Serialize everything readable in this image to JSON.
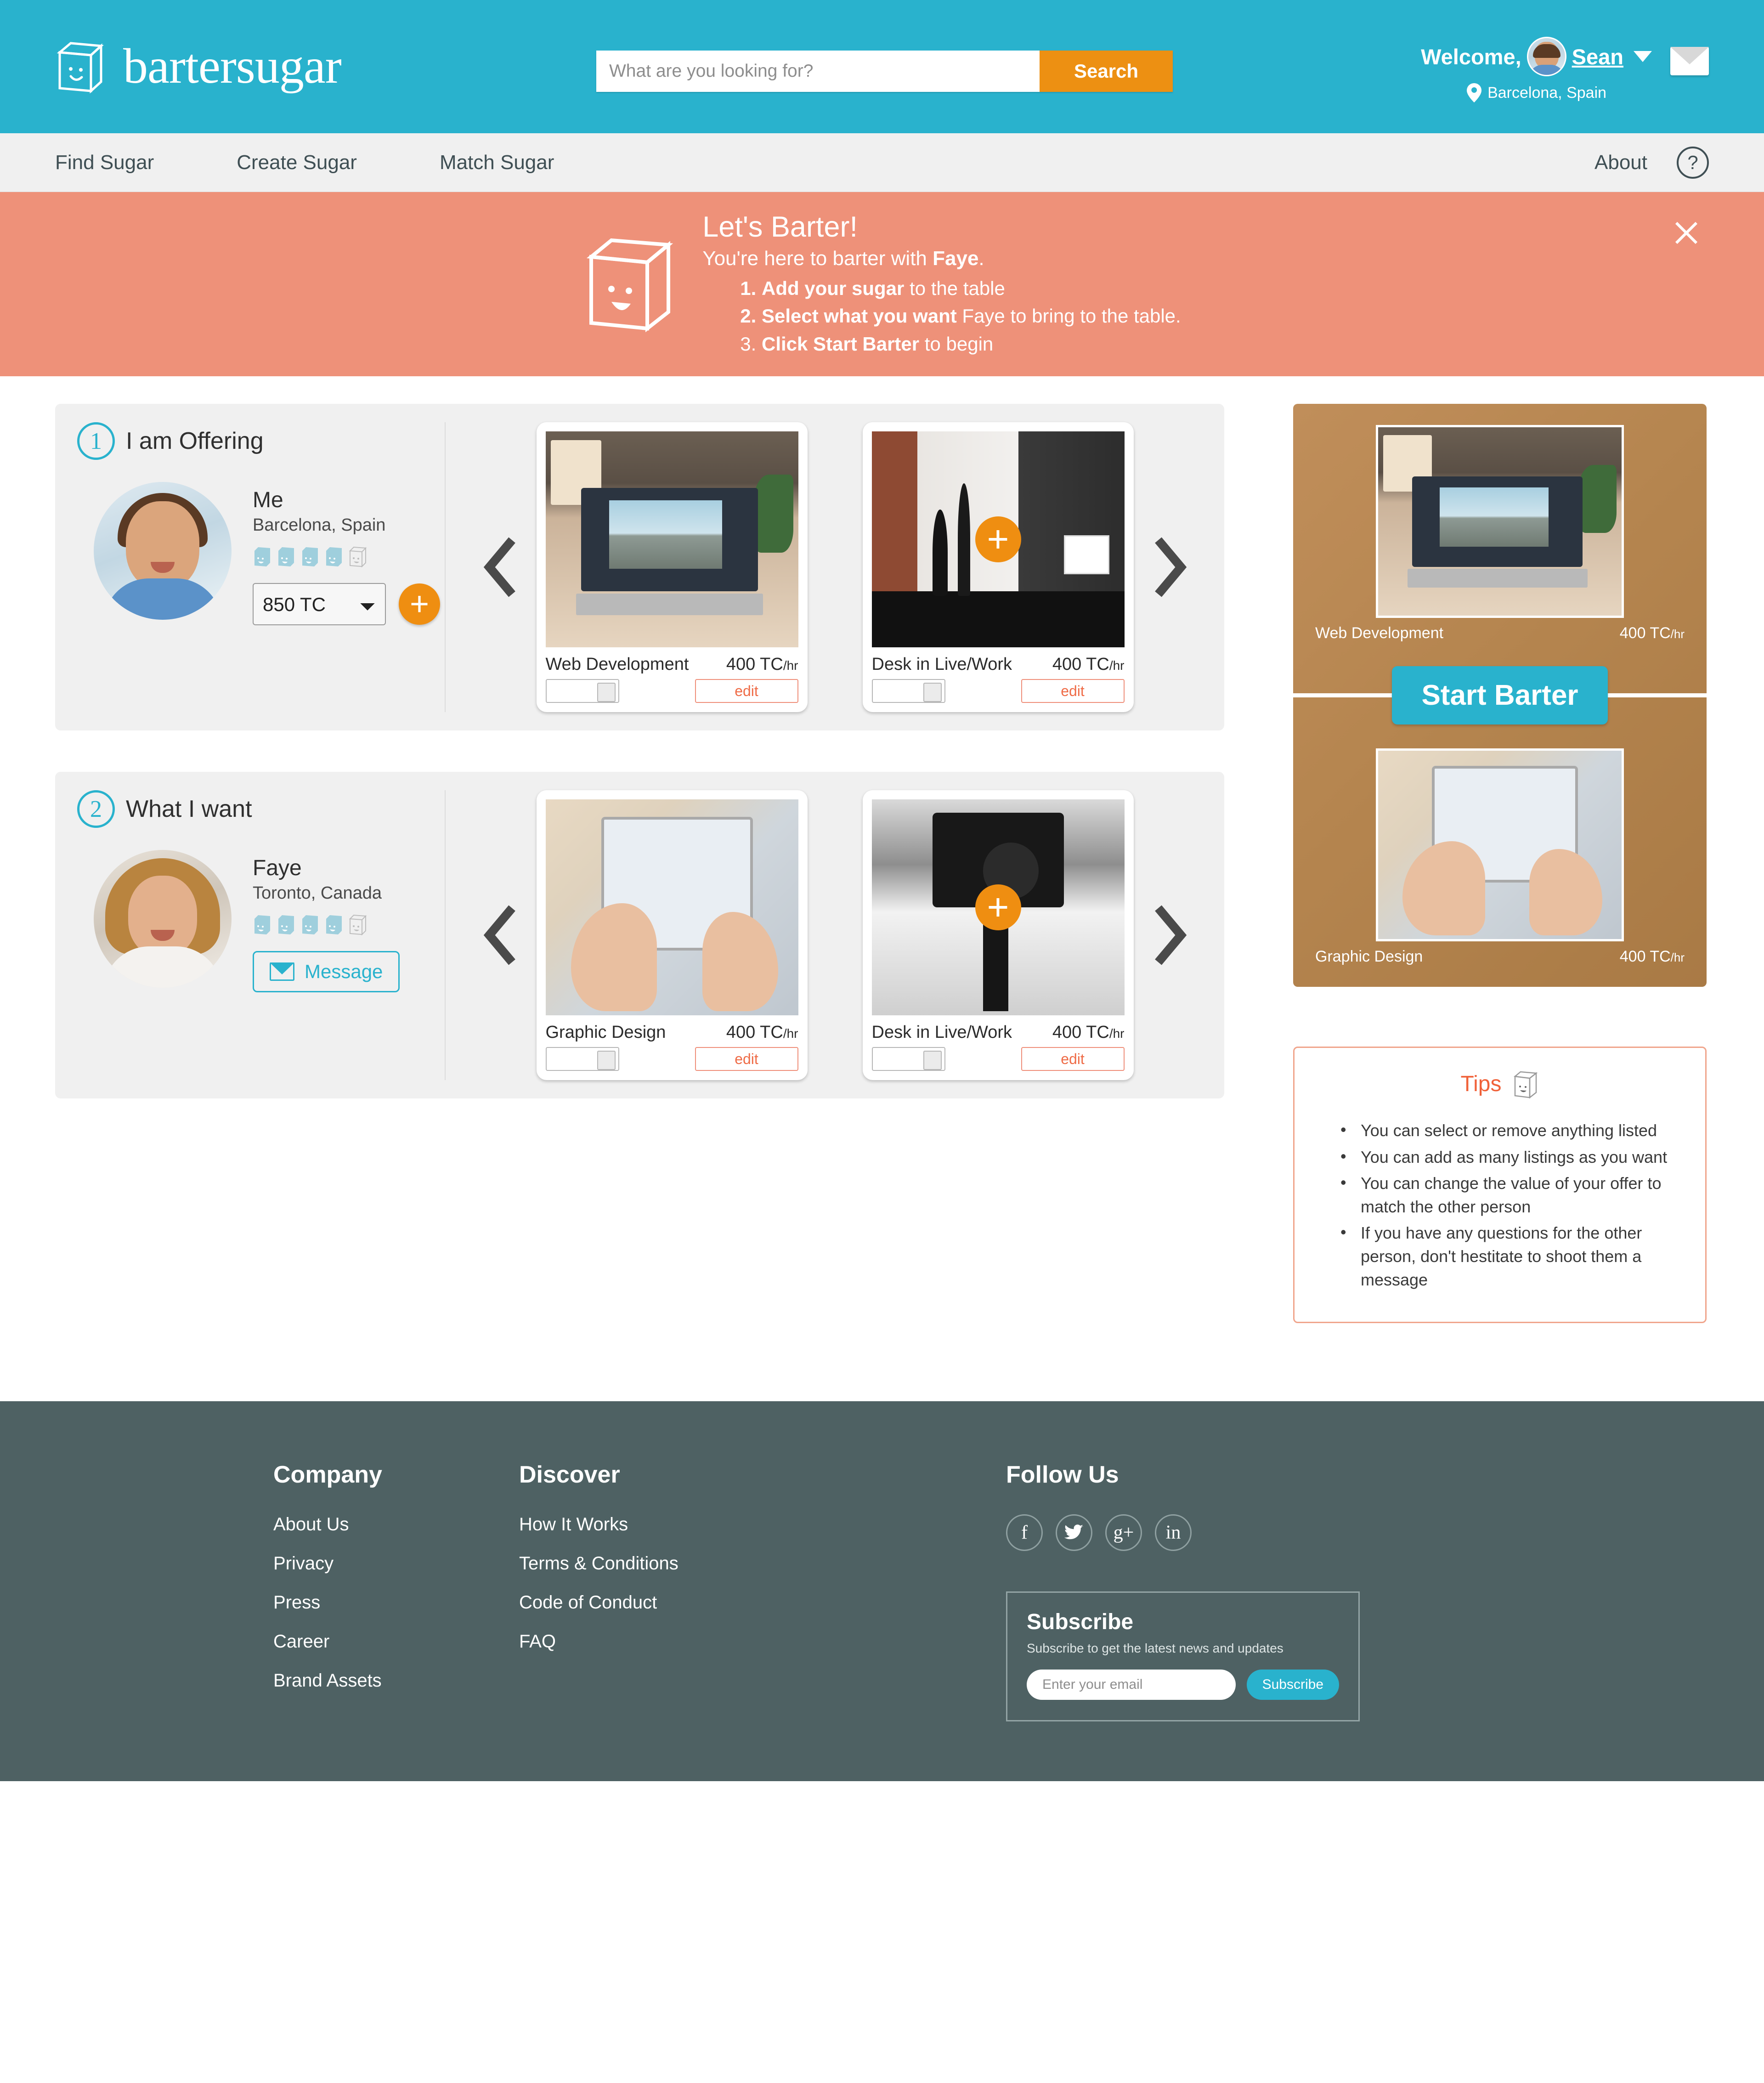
{
  "brand": {
    "name": "bartersugar",
    "logo_icon": "sugar-cube-icon"
  },
  "search": {
    "placeholder": "What are you looking for?",
    "value": "",
    "button_label": "Search"
  },
  "account": {
    "welcome_label": "Welcome,",
    "user_name": "Sean",
    "location": "Barcelona, Spain",
    "messages_icon": "envelope-icon",
    "dropdown_icon": "chevron-down-icon",
    "pin_icon": "location-pin-icon"
  },
  "nav": {
    "items": [
      {
        "label": "Find Sugar"
      },
      {
        "label": "Create Sugar"
      },
      {
        "label": "Match Sugar"
      }
    ],
    "about_label": "About",
    "help_label": "?"
  },
  "banner": {
    "title": "Let's Barter!",
    "subtitle_pre": "You're here to barter with ",
    "subtitle_strong": "Faye",
    "subtitle_post": ".",
    "steps": [
      {
        "num": "1.",
        "strong": "Add your sugar",
        "rest": " to the table"
      },
      {
        "num": "2.",
        "strong": "Select what you want",
        "rest": " Faye to bring to the table."
      },
      {
        "num": "3.",
        "strong": "Click Start Barter",
        "rest": " to begin"
      }
    ],
    "close_icon": "close-icon",
    "mascot_icon": "sugar-cube-mascot-icon",
    "bg_color": "#ee9179"
  },
  "offering": {
    "step_number": "1",
    "step_label": "I am Offering",
    "person": {
      "name": "Me",
      "location": "Barcelona, Spain",
      "rating_filled": 4,
      "rating_total": 5
    },
    "value_select": {
      "selected": "850 TC",
      "options": [
        "850 TC"
      ]
    },
    "add_icon": "plus-icon",
    "prev_icon": "chevron-left-icon",
    "next_icon": "chevron-right-icon",
    "cards": [
      {
        "title": "Web Development",
        "price": "400 TC",
        "unit": "/hr",
        "edit_label": "edit",
        "selected": true,
        "photo": "laptop-desk-photo"
      },
      {
        "title": "Desk in Live/Work",
        "price": "400 TC",
        "unit": "/hr",
        "edit_label": "edit",
        "selected": false,
        "photo": "loft-interior-photo"
      }
    ]
  },
  "wanted": {
    "step_number": "2",
    "step_label": "What I want",
    "person": {
      "name": "Faye",
      "location": "Toronto, Canada",
      "rating_filled": 4,
      "rating_total": 5
    },
    "message_button": "Message",
    "message_icon": "envelope-icon",
    "prev_icon": "chevron-left-icon",
    "next_icon": "chevron-right-icon",
    "cards": [
      {
        "title": "Graphic Design",
        "price": "400 TC",
        "unit": "/hr",
        "edit_label": "edit",
        "selected": true,
        "photo": "tablet-hands-photo"
      },
      {
        "title": "Desk in Live/Work",
        "price": "400 TC",
        "unit": "/hr",
        "edit_label": "edit",
        "selected": false,
        "photo": "camera-tripod-photo"
      }
    ]
  },
  "table": {
    "bg_color": "#b5854f",
    "start_button": "Start Barter",
    "remove_icon": "minus-icon",
    "offered": {
      "title": "Web Development",
      "price": "400 TC",
      "unit": "/hr"
    },
    "wanted": {
      "title": "Graphic Design",
      "price": "400 TC",
      "unit": "/hr"
    }
  },
  "tips": {
    "title": "Tips",
    "icon": "sugar-cube-icon",
    "border_color": "#f0a58c",
    "items": [
      "You can select or remove anything listed",
      "You can add as many listings as you want",
      "You can change the value of your offer to match the other person",
      "If you have any questions for the other person, don't hestitate to shoot them a message"
    ]
  },
  "footer": {
    "bg_color": "#4e6163",
    "company": {
      "title": "Company",
      "links": [
        "About Us",
        "Privacy",
        "Press",
        "Career",
        "Brand Assets"
      ]
    },
    "discover": {
      "title": "Discover",
      "links": [
        "How It Works",
        "Terms & Conditions",
        "Code of Conduct",
        "FAQ"
      ]
    },
    "follow": {
      "title": "Follow Us",
      "socials": [
        {
          "name": "facebook-icon",
          "glyph": "f"
        },
        {
          "name": "twitter-icon",
          "glyph": "t"
        },
        {
          "name": "google-plus-icon",
          "glyph": "g+"
        },
        {
          "name": "linkedin-icon",
          "glyph": "in"
        }
      ]
    },
    "subscribe": {
      "title": "Subscribe",
      "description": "Subscribe to get the latest news and updates",
      "placeholder": "Enter your email",
      "value": "",
      "button_label": "Subscribe"
    }
  }
}
